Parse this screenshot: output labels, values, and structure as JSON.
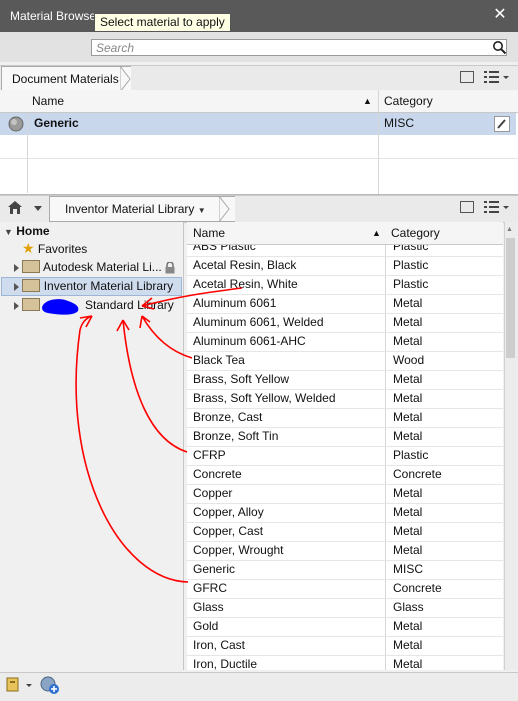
{
  "window": {
    "title": "Material Browser",
    "tooltip": "Select material to apply",
    "close_glyph": "✕"
  },
  "search": {
    "placeholder": "Search"
  },
  "document": {
    "breadcrumb": "Document Materials",
    "columns": {
      "name": "Name",
      "category": "Category",
      "sort_glyph": "▲"
    },
    "rows": [
      {
        "name": "Generic",
        "category": "MISC"
      }
    ]
  },
  "library": {
    "breadcrumb": "Inventor Material Library",
    "columns": {
      "name": "Name",
      "category": "Category",
      "sort_glyph": "▲"
    }
  },
  "tree": {
    "home": "Home",
    "items": [
      {
        "label": "Favorites"
      },
      {
        "label": "Autodesk Material Li..."
      },
      {
        "label": "Inventor Material Library"
      },
      {
        "label": "Standard Library"
      }
    ]
  },
  "materials": [
    {
      "name": "ABS Plastic",
      "category": "Plastic"
    },
    {
      "name": "Acetal Resin, Black",
      "category": "Plastic"
    },
    {
      "name": "Acetal Resin, White",
      "category": "Plastic"
    },
    {
      "name": "Aluminum 6061",
      "category": "Metal"
    },
    {
      "name": "Aluminum 6061, Welded",
      "category": "Metal"
    },
    {
      "name": "Aluminum 6061-AHC",
      "category": "Metal"
    },
    {
      "name": "Black Tea",
      "category": "Wood"
    },
    {
      "name": "Brass, Soft Yellow",
      "category": "Metal"
    },
    {
      "name": "Brass, Soft Yellow, Welded",
      "category": "Metal"
    },
    {
      "name": "Bronze, Cast",
      "category": "Metal"
    },
    {
      "name": "Bronze, Soft Tin",
      "category": "Metal"
    },
    {
      "name": "CFRP",
      "category": "Plastic"
    },
    {
      "name": "Concrete",
      "category": "Concrete"
    },
    {
      "name": "Copper",
      "category": "Metal"
    },
    {
      "name": "Copper, Alloy",
      "category": "Metal"
    },
    {
      "name": "Copper, Cast",
      "category": "Metal"
    },
    {
      "name": "Copper, Wrought",
      "category": "Metal"
    },
    {
      "name": "Generic",
      "category": "MISC"
    },
    {
      "name": "GFRC",
      "category": "Concrete"
    },
    {
      "name": "Glass",
      "category": "Glass"
    },
    {
      "name": "Gold",
      "category": "Metal"
    },
    {
      "name": "Iron, Cast",
      "category": "Metal"
    },
    {
      "name": "Iron, Ductile",
      "category": "Metal"
    }
  ],
  "colors": {
    "title_bg": "#595959",
    "selected_row": "#c8d7ec",
    "selected_tree": "#cfdcee",
    "annotation": "#ff0000",
    "scribble": "#0000ff"
  }
}
